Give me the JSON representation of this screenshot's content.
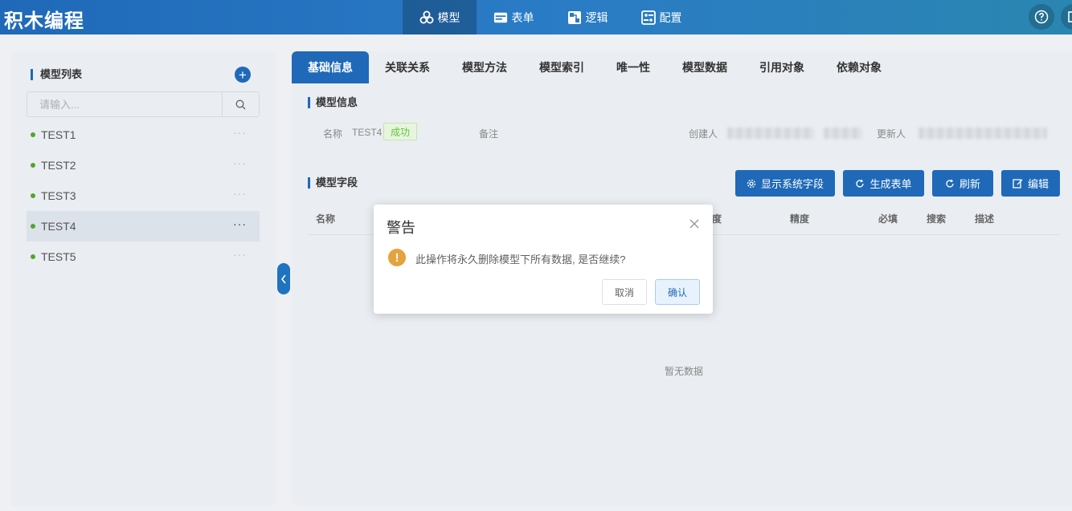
{
  "app": {
    "title": "积木编程"
  },
  "nav": [
    {
      "label": "模型",
      "icon": "cubes-icon",
      "active": true
    },
    {
      "label": "表单",
      "icon": "form-icon",
      "active": false
    },
    {
      "label": "逻辑",
      "icon": "logic-icon",
      "active": false
    },
    {
      "label": "配置",
      "icon": "config-icon",
      "active": false
    }
  ],
  "sidebar": {
    "title": "模型列表",
    "search_placeholder": "请输入...",
    "items": [
      {
        "label": "TEST1",
        "more": "···"
      },
      {
        "label": "TEST2",
        "more": "···"
      },
      {
        "label": "TEST3",
        "more": "···"
      },
      {
        "label": "TEST4",
        "more": "···",
        "selected": true
      },
      {
        "label": "TEST5",
        "more": "···"
      }
    ]
  },
  "tabs": [
    "基础信息",
    "关联关系",
    "模型方法",
    "模型索引",
    "唯一性",
    "模型数据",
    "引用对象",
    "依赖对象"
  ],
  "model_info": {
    "title": "模型信息",
    "name_label": "名称",
    "name_value": "TEST4",
    "status": "成功",
    "remark_label": "备注",
    "creator_label": "创建人",
    "updater_label": "更新人"
  },
  "model_fields": {
    "title": "模型字段",
    "buttons": {
      "show_system": "显示系统字段",
      "generate_form": "生成表单",
      "refresh": "刷新",
      "edit": "编辑"
    },
    "columns": [
      "名称",
      "度",
      "精度",
      "必填",
      "搜索",
      "描述"
    ],
    "empty_text": "暂无数据"
  },
  "dialog": {
    "title": "警告",
    "message": "此操作将永久删除模型下所有数据, 是否继续?",
    "cancel": "取消",
    "confirm": "确认"
  },
  "colors": {
    "primary": "#1f69b8",
    "success": "#67c23a",
    "warning": "#e6a23c"
  }
}
